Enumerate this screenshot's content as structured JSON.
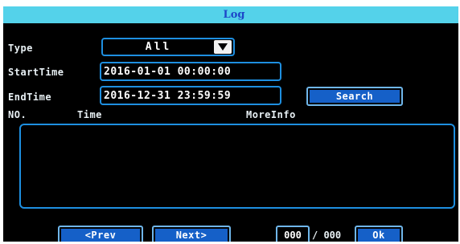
{
  "window": {
    "title": "Log"
  },
  "filters": {
    "type_label": "Type",
    "type_value": "All",
    "start_label": "StartTime",
    "start_value": "2016-01-01 00:00:00",
    "end_label": "EndTime",
    "end_value": "2016-12-31 23:59:59",
    "search_label": "Search"
  },
  "table": {
    "columns": [
      "NO.",
      "Time",
      "MoreInfo"
    ],
    "rows": []
  },
  "pager": {
    "prev_label": "<Prev",
    "next_label": "Next>",
    "current_page": "000",
    "total_text": "/ 000",
    "ok_label": "Ok"
  },
  "colors": {
    "titlebar": "#54d2ea",
    "title_text": "#1d47c9",
    "border": "#1e8fe0",
    "button_fill": "#1560c8",
    "background": "#000000"
  },
  "icons": {
    "dropdown": "triangle-down-icon"
  }
}
